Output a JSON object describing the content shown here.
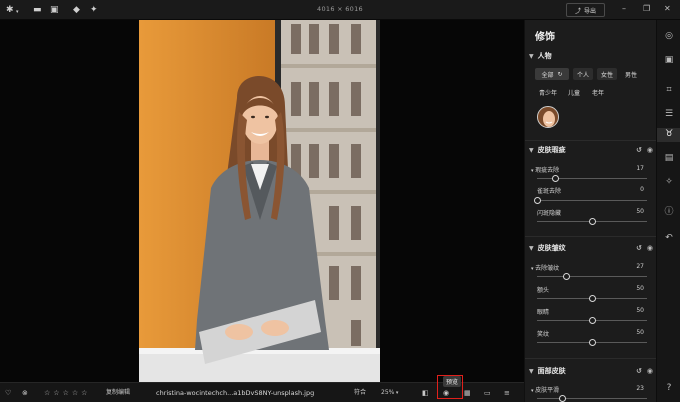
{
  "topbar": {
    "dimensions": "4016 × 6016",
    "export_label": "导出",
    "icons": [
      "logo-icon",
      "folder-icon",
      "image-icon",
      "eraser-icon",
      "wand-icon",
      "export-icon",
      "minimize-icon",
      "maximize-icon",
      "close-icon"
    ]
  },
  "bottombar": {
    "copy_edit": "复制编辑",
    "filename": "christina-wocintechch...a1bDvS8NY-unsplash.jpg",
    "fit": "符合",
    "zoom": "25%",
    "tooltip": "预览",
    "rating_stars": 5,
    "rating_value": 0
  },
  "panel": {
    "title": "修饰",
    "people": {
      "title": "人物",
      "filters": [
        {
          "label": "全部",
          "active": true
        },
        {
          "label": "个人",
          "active": false
        },
        {
          "label": "女性",
          "active": false
        },
        {
          "label": "男性",
          "active": false
        },
        {
          "label": "青少年",
          "active": false
        },
        {
          "label": "儿童",
          "active": false
        },
        {
          "label": "老年",
          "active": false
        }
      ]
    },
    "skin_blemish": {
      "title": "皮肤瑕疵",
      "rows": [
        {
          "label": "瑕疵去除",
          "value": "17",
          "fraction": 0.17
        },
        {
          "label": "雀斑去除",
          "value": "0",
          "fraction": 0.0
        },
        {
          "label": "闪斑隐藏",
          "value": "50",
          "fraction": 0.5
        }
      ]
    },
    "skin_wrinkles": {
      "title": "皮肤皱纹",
      "rows": [
        {
          "label": "去除皱纹",
          "value": "27",
          "fraction": 0.27
        },
        {
          "label": "额头",
          "value": "50",
          "fraction": 0.5
        },
        {
          "label": "眼睛",
          "value": "50",
          "fraction": 0.5
        },
        {
          "label": "笑纹",
          "value": "50",
          "fraction": 0.5
        }
      ]
    },
    "face_skin": {
      "title": "面部皮肤",
      "rows": [
        {
          "label": "皮肤平滑",
          "value": "23",
          "fraction": 0.23
        }
      ]
    }
  },
  "colors": {
    "accent_highlight": "#e0201b",
    "photo_background": "#d98a2e"
  }
}
